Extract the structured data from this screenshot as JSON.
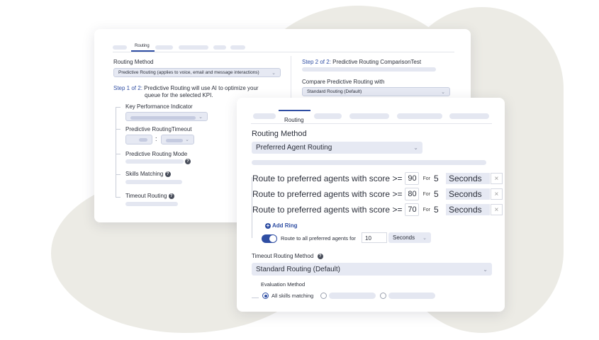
{
  "back_card": {
    "tab_active": "Routing",
    "routing_method_label": "Routing Method",
    "routing_method_value": "Predictive Routing (applies to voice, email and message interactions)",
    "step1_prefix": "Step 1 of 2:",
    "step1_text_line1": "Predictive Routing will use AI to optimize your",
    "step1_text_line2": "queue for the selected KPI.",
    "kpi_label": "Key Performance Indicator",
    "timeout_label": "Predictive RoutingTimeout",
    "timeout_sep": ":",
    "mode_label": "Predictive Routing Mode",
    "skills_label": "Skills Matching",
    "timeout_routing_label": "Timeout Routing",
    "step2_prefix": "Step 2 of 2:",
    "step2_text": "Predictive Routing ComparisonTest",
    "compare_label": "Compare Predictive Routing with",
    "compare_value": "Standard Routing (Default)"
  },
  "front_card": {
    "tab_active": "Routing",
    "routing_method_label": "Routing Method",
    "routing_method_value": "Preferred Agent Routing",
    "rings": [
      {
        "label": "Route to preferred agents with score >=",
        "score": "90",
        "for": "For",
        "num": "5",
        "unit": "Seconds"
      },
      {
        "label": "Route to preferred agents with score >=",
        "score": "80",
        "for": "For",
        "num": "5",
        "unit": "Seconds"
      },
      {
        "label": "Route to preferred agents with score >=",
        "score": "70",
        "for": "For",
        "num": "5",
        "unit": "Seconds"
      }
    ],
    "add_ring": "Add Ring",
    "route_all_label": "Route to all preferred agents for",
    "route_all_value": "10",
    "route_all_unit": "Seconds",
    "timeout_method_label": "Timeout Routing Method",
    "timeout_method_value": "Standard Routing (Default)",
    "evaluation_label": "Evaluation Method",
    "eval_option_1": "All skills matching"
  },
  "icons": {
    "close": "×",
    "chevron": "⌄",
    "question": "?",
    "plus": "+"
  },
  "colors": {
    "accent": "#2f4ea3",
    "placeholder": "#e4e7f1",
    "blob": "#ecebe5"
  }
}
